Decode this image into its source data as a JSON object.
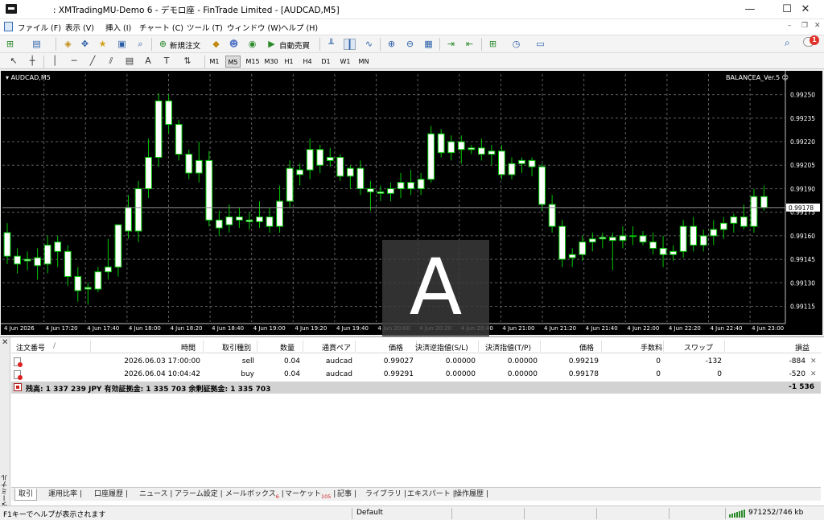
{
  "window": {
    "title": ": XMTradingMU-Demo 6 - デモロ座 - FinTrade Limited - [AUDCAD,M5]",
    "minimize": "—",
    "maximize": "☐",
    "close": "✕"
  },
  "menu": {
    "items": [
      "ファイル (F)",
      "表示 (V)",
      "挿入 (I)",
      "チャート (C)",
      "ツール (T)",
      "ウィンドウ (W)",
      "ヘルプ (H)"
    ],
    "notifications": "1"
  },
  "toolbar": {
    "new_order": "新規注文",
    "auto_trade": "自動売買",
    "timeframes": [
      "M1",
      "M5",
      "M15",
      "M30",
      "H1",
      "H4",
      "D1",
      "W1",
      "MN"
    ],
    "active_timeframe": "M5"
  },
  "chart": {
    "symbol_label": "AUDCAD,M5",
    "ea_label": "BALANCEA_Ver.5 ☺",
    "current_price": "0.99178",
    "overlay_letter": "A",
    "colors": {
      "background": "#000000",
      "bull": "#ffffff",
      "bear": "#ffffff",
      "wick": "#00c800",
      "grid": "#606060",
      "axis_text": "#ffffff"
    }
  },
  "chart_data": {
    "type": "candlestick",
    "y_ticks": [
      "0.99250",
      "0.99235",
      "0.99220",
      "0.99205",
      "0.99190",
      "0.99175",
      "0.99160",
      "0.99145",
      "0.99130",
      "0.99115"
    ],
    "ylim": [
      0.99105,
      0.99258
    ],
    "x_ticks": [
      "4 Jun 2026",
      "4 Jun 17:20",
      "4 Jun 17:40",
      "4 Jun 18:00",
      "4 Jun 18:20",
      "4 Jun 18:40",
      "4 Jun 19:00",
      "4 Jun 19:20",
      "4 Jun 19:40",
      "4 Jun 20:00",
      "4 Jun 20:20",
      "4 Jun 20:40",
      "4 Jun 21:00",
      "4 Jun 21:20",
      "4 Jun 21:40",
      "4 Jun 22:00",
      "4 Jun 22:20",
      "4 Jun 22:40",
      "4 Jun 23:00"
    ],
    "candles": [
      {
        "o": 0.99162,
        "h": 0.99168,
        "l": 0.99142,
        "c": 0.99147
      },
      {
        "o": 0.99147,
        "h": 0.99152,
        "l": 0.99136,
        "c": 0.99142
      },
      {
        "o": 0.99144,
        "h": 0.9915,
        "l": 0.99138,
        "c": 0.99145
      },
      {
        "o": 0.99146,
        "h": 0.99152,
        "l": 0.99132,
        "c": 0.99141
      },
      {
        "o": 0.99142,
        "h": 0.9916,
        "l": 0.99136,
        "c": 0.99154
      },
      {
        "o": 0.99156,
        "h": 0.9916,
        "l": 0.9914,
        "c": 0.9915
      },
      {
        "o": 0.9915,
        "h": 0.99154,
        "l": 0.99128,
        "c": 0.99134
      },
      {
        "o": 0.99134,
        "h": 0.9914,
        "l": 0.99118,
        "c": 0.99125
      },
      {
        "o": 0.99126,
        "h": 0.9913,
        "l": 0.99116,
        "c": 0.99127
      },
      {
        "o": 0.99126,
        "h": 0.9914,
        "l": 0.99124,
        "c": 0.99137
      },
      {
        "o": 0.99137,
        "h": 0.99158,
        "l": 0.99132,
        "c": 0.9914
      },
      {
        "o": 0.9914,
        "h": 0.99162,
        "l": 0.99134,
        "c": 0.99167
      },
      {
        "o": 0.99163,
        "h": 0.99186,
        "l": 0.99158,
        "c": 0.99178
      },
      {
        "o": 0.99163,
        "h": 0.99195,
        "l": 0.99156,
        "c": 0.9919
      },
      {
        "o": 0.9919,
        "h": 0.99222,
        "l": 0.99184,
        "c": 0.9921
      },
      {
        "o": 0.9921,
        "h": 0.99251,
        "l": 0.99204,
        "c": 0.99246
      },
      {
        "o": 0.99246,
        "h": 0.9925,
        "l": 0.99225,
        "c": 0.99231
      },
      {
        "o": 0.99231,
        "h": 0.99234,
        "l": 0.99208,
        "c": 0.99212
      },
      {
        "o": 0.99212,
        "h": 0.99215,
        "l": 0.99196,
        "c": 0.992
      },
      {
        "o": 0.992,
        "h": 0.9922,
        "l": 0.99194,
        "c": 0.99208
      },
      {
        "o": 0.99208,
        "h": 0.99214,
        "l": 0.99166,
        "c": 0.9917
      },
      {
        "o": 0.9917,
        "h": 0.99176,
        "l": 0.9916,
        "c": 0.99165
      },
      {
        "o": 0.99167,
        "h": 0.9918,
        "l": 0.99162,
        "c": 0.99172
      },
      {
        "o": 0.99172,
        "h": 0.99178,
        "l": 0.99165,
        "c": 0.9917
      },
      {
        "o": 0.9917,
        "h": 0.99175,
        "l": 0.99164,
        "c": 0.99169
      },
      {
        "o": 0.99169,
        "h": 0.99182,
        "l": 0.99165,
        "c": 0.99172
      },
      {
        "o": 0.99172,
        "h": 0.99178,
        "l": 0.99162,
        "c": 0.99166
      },
      {
        "o": 0.99166,
        "h": 0.99192,
        "l": 0.99162,
        "c": 0.99182
      },
      {
        "o": 0.99182,
        "h": 0.99208,
        "l": 0.99178,
        "c": 0.99203
      },
      {
        "o": 0.99199,
        "h": 0.99206,
        "l": 0.99192,
        "c": 0.99202
      },
      {
        "o": 0.99202,
        "h": 0.99222,
        "l": 0.99196,
        "c": 0.99215
      },
      {
        "o": 0.99215,
        "h": 0.99218,
        "l": 0.992,
        "c": 0.99205
      },
      {
        "o": 0.99208,
        "h": 0.99216,
        "l": 0.99204,
        "c": 0.9921
      },
      {
        "o": 0.9921,
        "h": 0.99212,
        "l": 0.99195,
        "c": 0.99198
      },
      {
        "o": 0.99198,
        "h": 0.99205,
        "l": 0.9919,
        "c": 0.99203
      },
      {
        "o": 0.99203,
        "h": 0.99208,
        "l": 0.99186,
        "c": 0.9919
      },
      {
        "o": 0.9919,
        "h": 0.99195,
        "l": 0.99176,
        "c": 0.99188
      },
      {
        "o": 0.99188,
        "h": 0.99192,
        "l": 0.99182,
        "c": 0.99187
      },
      {
        "o": 0.99187,
        "h": 0.99194,
        "l": 0.99182,
        "c": 0.9919
      },
      {
        "o": 0.9919,
        "h": 0.992,
        "l": 0.99184,
        "c": 0.99194
      },
      {
        "o": 0.99194,
        "h": 0.99202,
        "l": 0.99186,
        "c": 0.9919
      },
      {
        "o": 0.9919,
        "h": 0.992,
        "l": 0.99186,
        "c": 0.99196
      },
      {
        "o": 0.99196,
        "h": 0.9923,
        "l": 0.99194,
        "c": 0.99225
      },
      {
        "o": 0.99225,
        "h": 0.99228,
        "l": 0.9921,
        "c": 0.99213
      },
      {
        "o": 0.99213,
        "h": 0.99224,
        "l": 0.99208,
        "c": 0.9922
      },
      {
        "o": 0.9922,
        "h": 0.99224,
        "l": 0.99206,
        "c": 0.99215
      },
      {
        "o": 0.99215,
        "h": 0.99218,
        "l": 0.99212,
        "c": 0.99216
      },
      {
        "o": 0.99216,
        "h": 0.99222,
        "l": 0.99208,
        "c": 0.99212
      },
      {
        "o": 0.99212,
        "h": 0.99218,
        "l": 0.99205,
        "c": 0.99214
      },
      {
        "o": 0.99214,
        "h": 0.99218,
        "l": 0.99196,
        "c": 0.99199
      },
      {
        "o": 0.99199,
        "h": 0.9921,
        "l": 0.99196,
        "c": 0.99206
      },
      {
        "o": 0.99206,
        "h": 0.9921,
        "l": 0.992,
        "c": 0.99208
      },
      {
        "o": 0.99208,
        "h": 0.9921,
        "l": 0.99198,
        "c": 0.99204
      },
      {
        "o": 0.99204,
        "h": 0.99206,
        "l": 0.99176,
        "c": 0.9918
      },
      {
        "o": 0.9918,
        "h": 0.99186,
        "l": 0.99162,
        "c": 0.99166
      },
      {
        "o": 0.99166,
        "h": 0.9917,
        "l": 0.9914,
        "c": 0.99145
      },
      {
        "o": 0.99146,
        "h": 0.99152,
        "l": 0.9914,
        "c": 0.99148
      },
      {
        "o": 0.99148,
        "h": 0.9916,
        "l": 0.99144,
        "c": 0.99156
      },
      {
        "o": 0.99156,
        "h": 0.99162,
        "l": 0.9915,
        "c": 0.99158
      },
      {
        "o": 0.99158,
        "h": 0.99162,
        "l": 0.99152,
        "c": 0.99159
      },
      {
        "o": 0.99159,
        "h": 0.99162,
        "l": 0.99138,
        "c": 0.99157
      },
      {
        "o": 0.99157,
        "h": 0.99166,
        "l": 0.99152,
        "c": 0.9916
      },
      {
        "o": 0.9916,
        "h": 0.99166,
        "l": 0.99154,
        "c": 0.9916
      },
      {
        "o": 0.9916,
        "h": 0.99163,
        "l": 0.99154,
        "c": 0.99156
      },
      {
        "o": 0.99156,
        "h": 0.99162,
        "l": 0.99148,
        "c": 0.99152
      },
      {
        "o": 0.99152,
        "h": 0.9916,
        "l": 0.9914,
        "c": 0.99148
      },
      {
        "o": 0.99148,
        "h": 0.99154,
        "l": 0.99144,
        "c": 0.9915
      },
      {
        "o": 0.9915,
        "h": 0.9917,
        "l": 0.99146,
        "c": 0.99166
      },
      {
        "o": 0.99166,
        "h": 0.99172,
        "l": 0.9915,
        "c": 0.99154
      },
      {
        "o": 0.99154,
        "h": 0.99164,
        "l": 0.9915,
        "c": 0.9916
      },
      {
        "o": 0.9916,
        "h": 0.9917,
        "l": 0.99154,
        "c": 0.99164
      },
      {
        "o": 0.99164,
        "h": 0.99172,
        "l": 0.99158,
        "c": 0.99168
      },
      {
        "o": 0.99168,
        "h": 0.99174,
        "l": 0.99162,
        "c": 0.99172
      },
      {
        "o": 0.99172,
        "h": 0.9918,
        "l": 0.99164,
        "c": 0.99166
      },
      {
        "o": 0.99166,
        "h": 0.9919,
        "l": 0.99162,
        "c": 0.99185
      },
      {
        "o": 0.99185,
        "h": 0.99192,
        "l": 0.99176,
        "c": 0.99178
      }
    ]
  },
  "terminal": {
    "side_label": "ターミナル",
    "columns": [
      "注文番号",
      "/",
      "時間",
      "取引種別",
      "数量",
      "通貨ペア",
      "価格",
      "決済逆指値(S/L)",
      "決済指値(T/P)",
      "価格",
      "手数料",
      "スワップ",
      "損益"
    ],
    "orders": [
      {
        "time": "2026.06.03 17:00:00",
        "type": "sell",
        "volume": "0.04",
        "symbol": "audcad",
        "open_price": "0.99027",
        "sl": "0.00000",
        "tp": "0.00000",
        "price": "0.99219",
        "commission": "0",
        "swap": "-132",
        "profit": "-884",
        "close": "✕"
      },
      {
        "time": "2026.06.04 10:04:42",
        "type": "buy",
        "volume": "0.04",
        "symbol": "audcad",
        "open_price": "0.99291",
        "sl": "0.00000",
        "tp": "0.00000",
        "price": "0.99178",
        "commission": "0",
        "swap": "0",
        "profit": "-520",
        "close": "✕"
      }
    ],
    "balance_summary": "残高: 1 337 239 JPY  有効証拠金: 1 335 703  余剰証拠金: 1 335 703",
    "total_profit": "-1 536",
    "tabs": [
      {
        "label": "取引",
        "badge": ""
      },
      {
        "label": "運用比率",
        "badge": ""
      },
      {
        "label": "口座履歴",
        "badge": ""
      },
      {
        "label": "ニュース",
        "badge": ""
      },
      {
        "label": "アラーム設定",
        "badge": ""
      },
      {
        "label": "メールボックス",
        "badge": "6"
      },
      {
        "label": "マーケット",
        "badge": "105"
      },
      {
        "label": "記事",
        "badge": ""
      },
      {
        "label": "ライブラリ",
        "badge": ""
      },
      {
        "label": "エキスパート",
        "badge": ""
      },
      {
        "label": "操作履歴",
        "badge": ""
      }
    ]
  },
  "status": {
    "help": "F1キーでヘルプが表示されます",
    "profile": "Default",
    "traffic": "971252/746 kb"
  }
}
